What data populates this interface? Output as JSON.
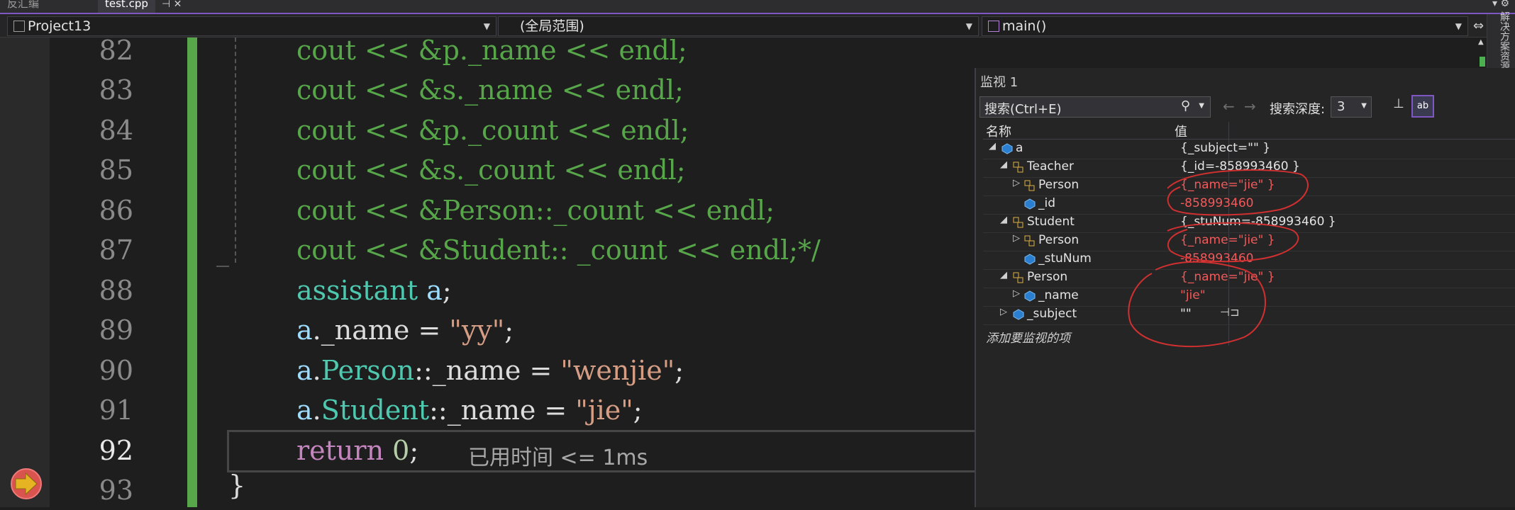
{
  "tabs": {
    "inactive_label": "反汇编",
    "active_label": "test.cpp"
  },
  "navbar": {
    "project": "Project13",
    "scope": "(全局范围)",
    "function": "main()"
  },
  "side_panel_label": "解决方案资源",
  "editor": {
    "lines": [
      {
        "num": "82",
        "code": "cout << &p._name << endl;"
      },
      {
        "num": "83",
        "code": "cout << &s._name << endl;"
      },
      {
        "num": "84",
        "code": "cout << &p._count << endl;"
      },
      {
        "num": "85",
        "code": "cout << &s._count << endl;"
      },
      {
        "num": "86",
        "code": "cout << &Person::_count << endl;"
      },
      {
        "num": "87",
        "code": "cout << &Student:: _count << endl;*/"
      },
      {
        "num": "88"
      },
      {
        "num": "89"
      },
      {
        "num": "90"
      },
      {
        "num": "91"
      },
      {
        "num": "92"
      },
      {
        "num": "93"
      }
    ],
    "line88": {
      "type": "assistant",
      "var": "a",
      "semi": ";"
    },
    "line89": {
      "obj": "a",
      "member": "._name = ",
      "str": "\"yy\"",
      "end": ";"
    },
    "line90": {
      "obj": "a",
      "dot": ".",
      "type": "Person",
      "member": "::_name = ",
      "str": "\"wenjie\"",
      "end": ";"
    },
    "line91": {
      "obj": "a",
      "dot": ".",
      "type": "Student",
      "member": "::_name = ",
      "str": "\"jie\"",
      "end": ";"
    },
    "line92": {
      "kw": "return",
      "num": "0",
      "end": ";"
    },
    "line93_brace": "}",
    "elapsed": "已用时间 <= 1ms"
  },
  "watch": {
    "title": "监视 1",
    "search_placeholder": "搜索(Ctrl+E)",
    "depth_label": "搜索深度:",
    "depth_value": "3",
    "col_name": "名称",
    "col_value": "值",
    "rows": [
      {
        "name": "a",
        "value": "{_subject=\"\" }",
        "changed": false
      },
      {
        "name": "Teacher",
        "value": "{_id=-858993460 }",
        "changed": false
      },
      {
        "name": "Person",
        "value": "{_name=\"jie\" }",
        "changed": true
      },
      {
        "name": "_id",
        "value": "-858993460",
        "changed": true
      },
      {
        "name": "Student",
        "value": "{_stuNum=-858993460 }",
        "changed": false
      },
      {
        "name": "Person",
        "value": "{_name=\"jie\" }",
        "changed": true
      },
      {
        "name": "_stuNum",
        "value": "-858993460",
        "changed": true
      },
      {
        "name": "Person",
        "value": "{_name=\"jie\" }",
        "changed": true
      },
      {
        "name": "_name",
        "value": "\"jie\"",
        "changed": true
      },
      {
        "name": "_subject",
        "value": "\"\"",
        "changed": false
      }
    ],
    "add_item": "添加要监视的项"
  },
  "colors": {
    "accent": "#7e57c2",
    "changed_value": "#f05a5a",
    "comment": "#57a64a",
    "type": "#4ec9b0",
    "string": "#d69d85",
    "keyword": "#c586c0"
  }
}
